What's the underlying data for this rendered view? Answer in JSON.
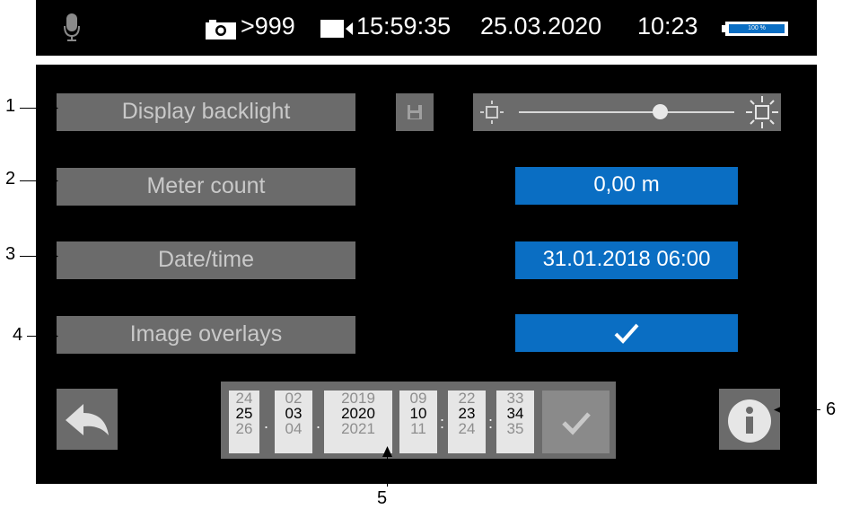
{
  "status_bar": {
    "mic_icon": "microphone-icon",
    "camera_icon": "camera-icon",
    "photo_count": ">999",
    "video_icon": "video-camera-icon",
    "video_time": "15:59:35",
    "date": "25.03.2020",
    "time": "10:23",
    "battery_label": "100 %",
    "battery_level": 1.0
  },
  "settings": {
    "display_backlight": {
      "label": "Display backlight",
      "brightness_level": 0.67
    },
    "meter_count": {
      "label": "Meter count",
      "value": "0,00 m"
    },
    "date_time": {
      "label": "Date/time",
      "value": "31.01.2018 06:00"
    },
    "image_overlays": {
      "label": "Image overlays",
      "enabled": true
    }
  },
  "date_picker": {
    "day": [
      "24",
      "25",
      "26"
    ],
    "month": [
      "02",
      "03",
      "04"
    ],
    "year": [
      "2019",
      "2020",
      "2021"
    ],
    "hour": [
      "09",
      "10",
      "11"
    ],
    "minute": [
      "22",
      "23",
      "24"
    ],
    "second": [
      "33",
      "34",
      "35"
    ],
    "separators": [
      ".",
      ".",
      ":",
      ":"
    ]
  },
  "callouts": [
    "1",
    "2",
    "3",
    "4",
    "5",
    "6"
  ],
  "colors": {
    "accent_blue": "#0a6ec3",
    "button_gray": "#6b6b6b",
    "background": "#000000"
  }
}
